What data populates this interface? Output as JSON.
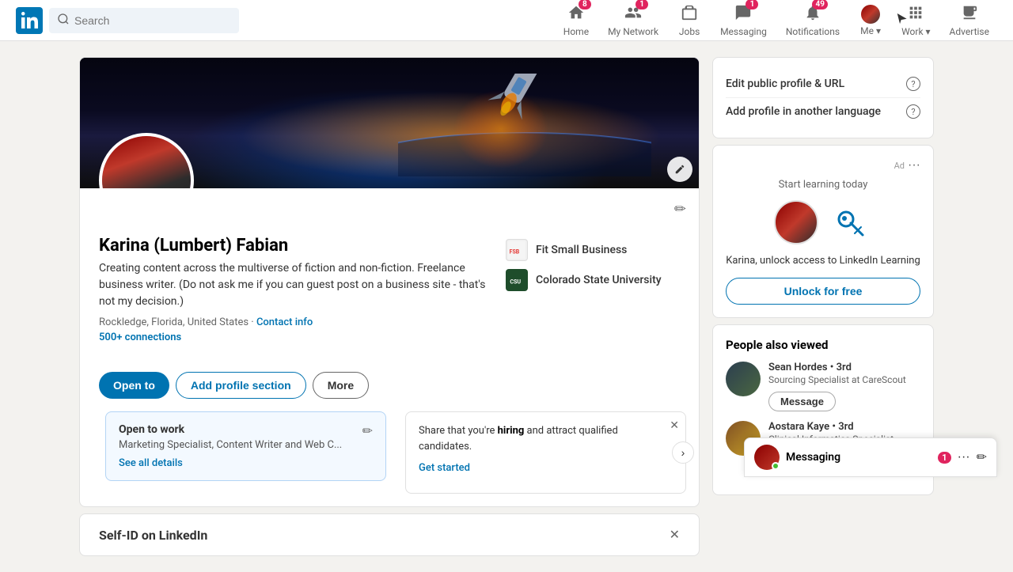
{
  "navbar": {
    "search_placeholder": "Search",
    "nav_items": [
      {
        "id": "home",
        "label": "Home",
        "badge": "8",
        "badge_type": "red"
      },
      {
        "id": "my-network",
        "label": "My Network",
        "badge": "1",
        "badge_type": "red"
      },
      {
        "id": "jobs",
        "label": "Jobs",
        "badge": null
      },
      {
        "id": "messaging",
        "label": "Messaging",
        "badge": "1",
        "badge_type": "red"
      },
      {
        "id": "notifications",
        "label": "Notifications",
        "badge": "49",
        "badge_type": "red"
      },
      {
        "id": "me",
        "label": "Me ▾",
        "badge": null
      },
      {
        "id": "work",
        "label": "Work ▾",
        "badge": null
      },
      {
        "id": "advertise",
        "label": "Advertise",
        "badge": null
      }
    ]
  },
  "profile": {
    "name": "Karina (Lumbert) Fabian",
    "bio": "Creating content across the multiverse of fiction and non-fiction. Freelance business writer. (Do not ask me if you can guest post on a business site - that's not my decision.)",
    "location": "Rockledge, Florida, United States",
    "contact_label": "Contact info",
    "connections": "500+ connections",
    "companies": [
      {
        "name": "Fit Small Business",
        "logo_type": "fit",
        "logo_text": "FSB"
      },
      {
        "name": "Colorado State University",
        "logo_type": "csu",
        "logo_text": "CSU"
      }
    ],
    "actions": {
      "open_to": "Open to",
      "add_profile_section": "Add profile section",
      "more": "More"
    }
  },
  "open_to_work": {
    "title": "Open to work",
    "subtitle": "Marketing Specialist, Content Writer and Web C...",
    "see_details": "See all details",
    "edit_icon": "✏"
  },
  "hiring_card": {
    "text_before": "Share that you're ",
    "text_highlight": "hiring",
    "text_after": " and attract qualified candidates.",
    "cta": "Get started"
  },
  "self_id": {
    "title": "Self-ID on LinkedIn"
  },
  "right_panel": {
    "edit_profile_url_label": "Edit public profile & URL",
    "add_language_label": "Add profile in another language",
    "ad": {
      "label": "Ad",
      "learn_today": "Start learning today",
      "message": "Karina, unlock access to LinkedIn Learning",
      "unlock_btn": "Unlock for free"
    },
    "people_also_viewed": {
      "title": "People also viewed",
      "people": [
        {
          "name": "Sean Hordes • 3rd",
          "title": "Sourcing Specialist at CareScout",
          "message_btn": "Message",
          "avatar_class": "sean"
        },
        {
          "name": "Aostara Kaye • 3rd",
          "title": "Clinical Informatics Specialist, Analytic Solutions, UCLA Health IT, O...",
          "avatar_class": "aostara"
        }
      ]
    }
  },
  "messaging_bar": {
    "label": "Messaging",
    "badge": "1"
  }
}
